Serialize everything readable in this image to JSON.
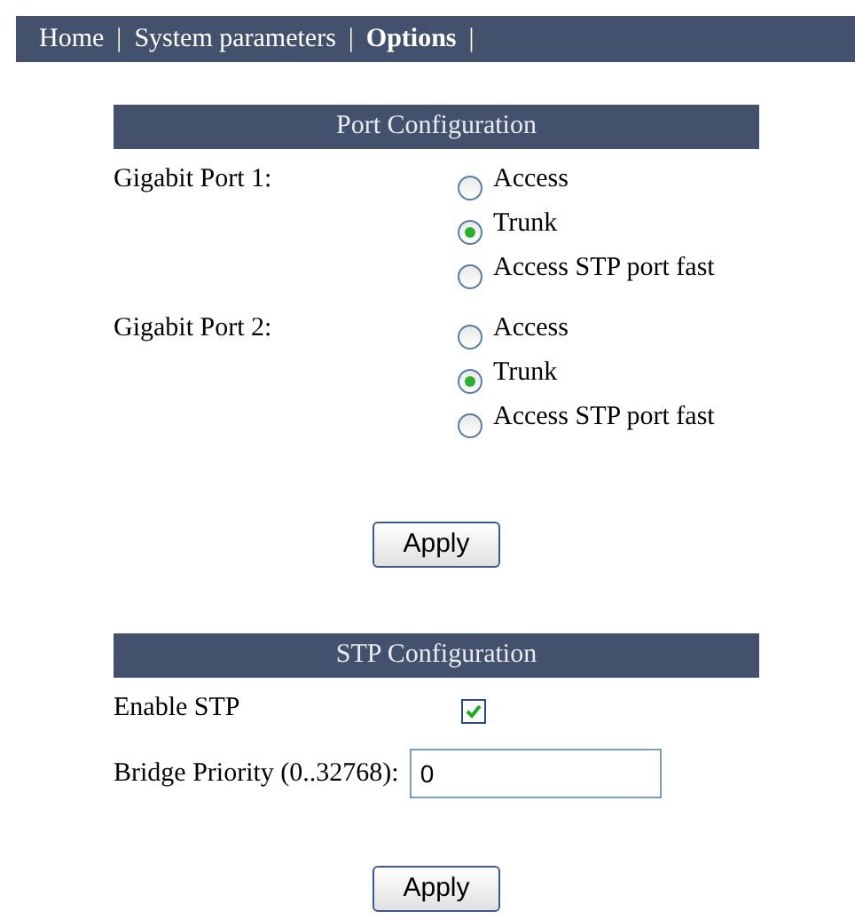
{
  "nav": [
    {
      "label": "Home",
      "selected": false,
      "separator": "|"
    },
    {
      "label": "System parameters",
      "selected": false,
      "separator": "|"
    },
    {
      "label": "Options",
      "selected": true,
      "separator": "|"
    }
  ],
  "port_configuration": {
    "title": "Port Configuration",
    "ports": [
      {
        "label": "Gigabit Port 1:",
        "options": [
          {
            "label": "Access",
            "selected": false
          },
          {
            "label": "Trunk",
            "selected": true
          },
          {
            "label": "Access STP port fast",
            "selected": false
          }
        ]
      },
      {
        "label": "Gigabit Port 2:",
        "options": [
          {
            "label": "Access",
            "selected": false
          },
          {
            "label": "Trunk",
            "selected": true
          },
          {
            "label": "Access STP port fast",
            "selected": false
          }
        ]
      }
    ],
    "apply": "Apply"
  },
  "stp_configuration": {
    "title": "STP Configuration",
    "enable_label": "Enable STP",
    "enable_checked": true,
    "priority_label": "Bridge Priority (0..32768):",
    "priority_value": "0",
    "apply": "Apply"
  }
}
